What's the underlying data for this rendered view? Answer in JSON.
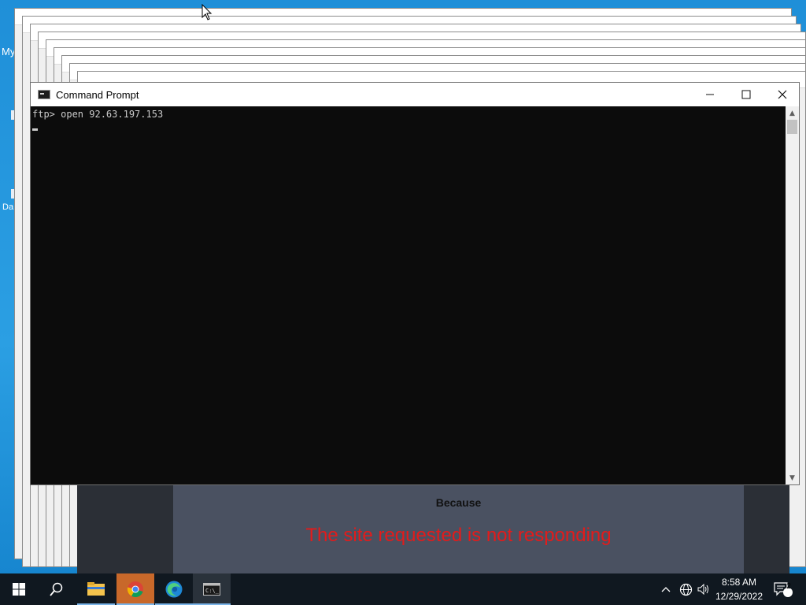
{
  "desktop": {
    "labels": [
      "My",
      "Da"
    ]
  },
  "background_page": {
    "because": "Because",
    "message": "The site requested is not responding"
  },
  "cmd_window": {
    "title": "Command Prompt",
    "lines": [
      "ftp> open 92.63.197.153"
    ],
    "minimize_glyph": "—",
    "maximize_glyph": "☐",
    "close_glyph": "✕"
  },
  "taskbar": {
    "apps": [
      {
        "name": "start-icon"
      },
      {
        "name": "search-icon"
      },
      {
        "name": "file-explorer-icon"
      },
      {
        "name": "chrome-icon"
      },
      {
        "name": "edge-icon"
      },
      {
        "name": "command-prompt-icon"
      }
    ],
    "clock_time": "8:58 AM",
    "clock_date": "12/29/2022",
    "notification_count": "2"
  },
  "colors": {
    "desktop": "#1f8fd8",
    "taskbar": "#101820",
    "console_bg": "#0c0c0c",
    "console_text": "#cccccc",
    "error_text": "#e31b1b"
  }
}
